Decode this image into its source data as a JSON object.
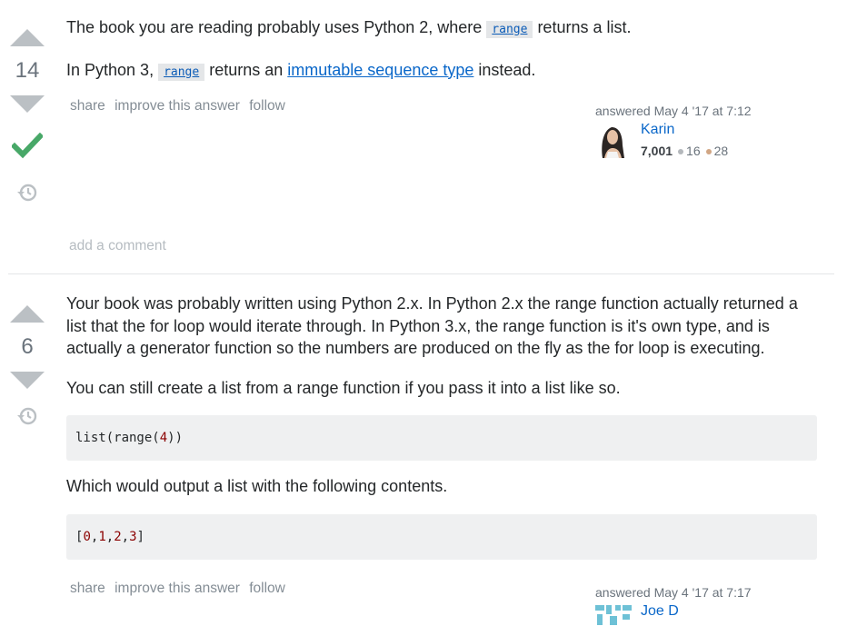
{
  "answer1": {
    "votes": "14",
    "para1": {
      "pre": "The book you are reading probably uses Python 2, where ",
      "code": "range",
      "post": " returns a list."
    },
    "para2": {
      "pre": "In Python 3, ",
      "code": "range",
      "mid": " returns an ",
      "link": "immutable sequence type",
      "post": " instead."
    },
    "menu": {
      "share": "share",
      "improve": "improve this answer",
      "follow": "follow"
    },
    "signature": {
      "action": "answered May 4 '17 at 7:12",
      "user": "Karin",
      "reputation": "7,001",
      "silver": "16",
      "bronze": "28"
    },
    "add_comment": "add a comment"
  },
  "answer2": {
    "votes": "6",
    "para1": "Your book was probably written using Python 2.x. In Python 2.x the range function actually returned a list that the for loop would iterate through. In Python 3.x, the range function is it's own type, and is actually a generator function so the numbers are produced on the fly as the for loop is executing.",
    "para2": "You can still create a list from a range function if you pass it into a list like so.",
    "code1": {
      "a": "list(range(",
      "n": "4",
      "b": "))"
    },
    "para3": "Which would output a list with the following contents.",
    "code2": {
      "open": "[",
      "n0": "0",
      "n1": "1",
      "n2": "2",
      "n3": "3",
      "close": "]",
      "sep": ","
    },
    "menu": {
      "share": "share",
      "improve": "improve this answer",
      "follow": "follow"
    },
    "signature": {
      "action": "answered May 4 '17 at 7:17",
      "user": "Joe D"
    }
  },
  "colors": {
    "accepted": "#48a868",
    "link": "#0a67c9",
    "silver": "#b4b8bc",
    "bronze": "#d1a684"
  },
  "icons": [
    "vote-up-icon",
    "vote-down-icon",
    "accepted-check-icon",
    "history-icon",
    "user-avatar"
  ]
}
